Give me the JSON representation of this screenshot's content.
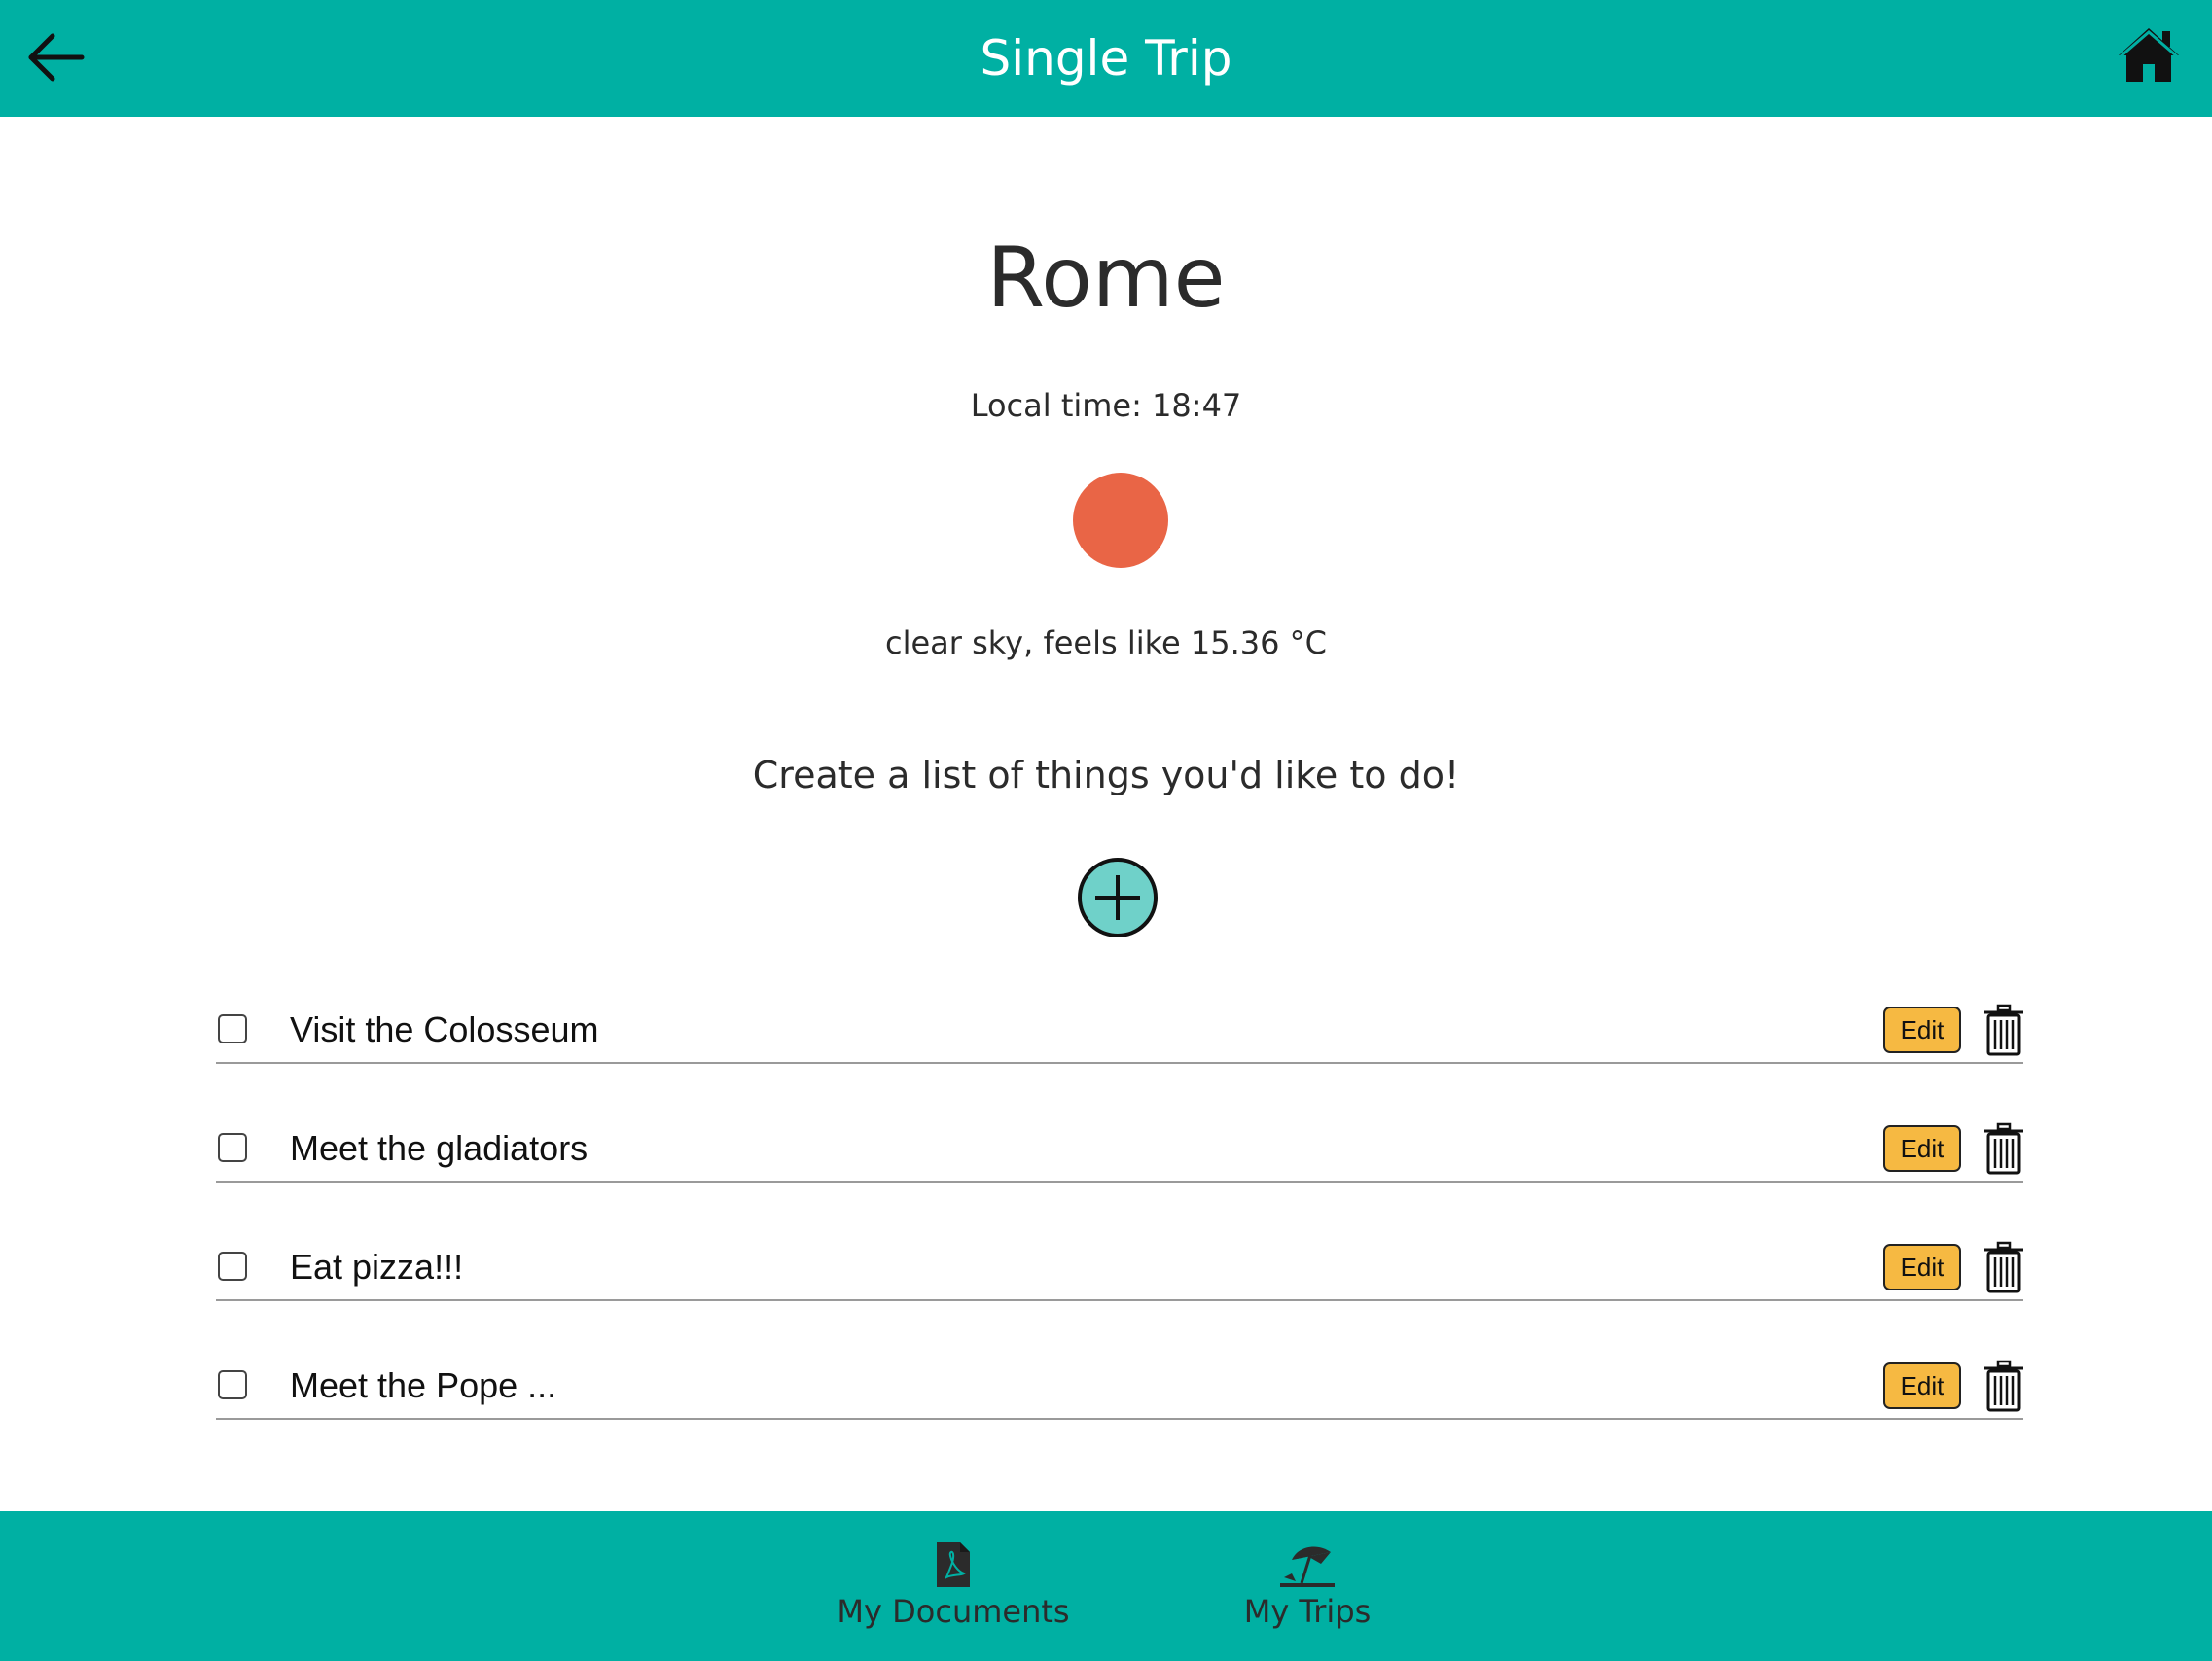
{
  "header": {
    "title": "Single Trip",
    "back_icon": "arrow-left-icon",
    "home_icon": "home-icon"
  },
  "trip": {
    "city": "Rome",
    "local_time": "Local time: 18:47",
    "weather_icon": "sun-icon",
    "weather_color": "#e96546",
    "weather_description": "clear sky, feels like 15.36 °C"
  },
  "todo": {
    "prompt": "Create a list of things you'd like to do!",
    "add_icon": "plus-circle-icon",
    "items": [
      {
        "label": "Visit the Colosseum",
        "checked": false,
        "edit_label": "Edit"
      },
      {
        "label": "Meet the gladiators",
        "checked": false,
        "edit_label": "Edit"
      },
      {
        "label": "Eat pizza!!!",
        "checked": false,
        "edit_label": "Edit"
      },
      {
        "label": "Meet the Pope ...",
        "checked": false,
        "edit_label": "Edit"
      }
    ]
  },
  "bottom_nav": {
    "items": [
      {
        "label": "My Documents",
        "icon": "pdf-document-icon"
      },
      {
        "label": "My Trips",
        "icon": "beach-umbrella-icon"
      }
    ]
  },
  "colors": {
    "brand": "#00b0a3",
    "edit_button": "#f6b942",
    "add_button": "#6fd1c9"
  }
}
